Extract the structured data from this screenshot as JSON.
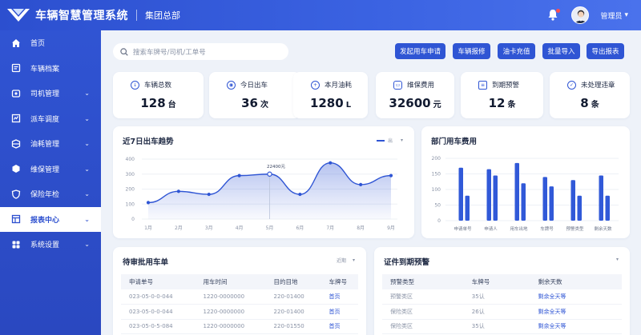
{
  "header": {
    "app_title": "车辆智慧管理系统",
    "org": "集团总部",
    "user_name": "管理员"
  },
  "sidebar": {
    "items": [
      {
        "label": "首页",
        "icon": "home-icon",
        "has_children": false
      },
      {
        "label": "车辆档案",
        "icon": "vehicle-file-icon",
        "has_children": false
      },
      {
        "label": "司机管理",
        "icon": "driver-icon",
        "has_children": true
      },
      {
        "label": "派车调度",
        "icon": "dispatch-icon",
        "has_children": true
      },
      {
        "label": "油耗管理",
        "icon": "fuel-icon",
        "has_children": true
      },
      {
        "label": "维保管理",
        "icon": "maintenance-icon",
        "has_children": true
      },
      {
        "label": "保险年检",
        "icon": "insurance-icon",
        "has_children": true
      },
      {
        "label": "报表中心",
        "icon": "report-icon",
        "has_children": true,
        "active": true
      },
      {
        "label": "系统设置",
        "icon": "settings-icon",
        "has_children": true
      }
    ]
  },
  "search": {
    "placeholder": "搜索车牌号/司机/工单号"
  },
  "actions": [
    "发起用车申请",
    "车辆报修",
    "油卡充值",
    "批量导入",
    "导出报表"
  ],
  "stats": [
    {
      "label": "车辆总数",
      "value": "128",
      "unit": "台"
    },
    {
      "label": "今日出车",
      "value": "36",
      "unit": "次"
    },
    {
      "label": "本月油耗",
      "value": "1280",
      "unit": "L"
    },
    {
      "label": "维保费用",
      "value": "32600",
      "unit": "元"
    },
    {
      "label": "到期预警",
      "value": "12",
      "unit": "条"
    },
    {
      "label": "未处理违章",
      "value": "8",
      "unit": "条"
    }
  ],
  "trend_card": {
    "title": "近7日出车趋势",
    "legend": "出"
  },
  "dept_card": {
    "title": "部门用车费用"
  },
  "pending_card": {
    "title": "待审批用车单",
    "filter": "近期",
    "columns": [
      "申请单号",
      "用车时间",
      "目的目地",
      "车牌号"
    ],
    "rows": [
      [
        "023-05-0-0-044",
        "1220-0000000",
        "220-01400",
        "首页"
      ],
      [
        "023-05-0-0-044",
        "1220-0000000",
        "220-01400",
        "首页"
      ],
      [
        "023-05-0-5-084",
        "1220-0000000",
        "220-01550",
        "首页"
      ]
    ]
  },
  "cert_card": {
    "title": "证件到期预警",
    "columns": [
      "预警类型",
      "车牌号",
      "剩余天数"
    ],
    "rows": [
      [
        "预警类区",
        "35认",
        "剩余全天等"
      ],
      [
        "保险类区",
        "26认",
        "剩余全天等"
      ],
      [
        "保险类区",
        "35认",
        "剩余全天等"
      ]
    ]
  },
  "chart_data": [
    {
      "type": "line",
      "title": "近7日出车趋势",
      "x": [
        "1月",
        "2月",
        "3月",
        "4月",
        "5月",
        "6月",
        "7月",
        "8月",
        "9月"
      ],
      "values": [
        110,
        185,
        165,
        290,
        300,
        165,
        375,
        230,
        290
      ],
      "ylim": [
        0,
        400
      ],
      "yticks": [
        0,
        100,
        200,
        300,
        400
      ],
      "annotation": {
        "label": "22400元",
        "index": 4
      },
      "color": "#2f55d4"
    },
    {
      "type": "bar",
      "title": "部门用车费用",
      "categories": [
        "申请单号",
        "申请人",
        "用车出地",
        "车牌号",
        "预警类型",
        "剩余天数"
      ],
      "series": [
        {
          "values": [
            170,
            165,
            185,
            140,
            130,
            145
          ]
        },
        {
          "values": [
            80,
            145,
            120,
            110,
            80,
            80
          ]
        }
      ],
      "ylim": [
        0,
        200
      ],
      "yticks": [
        0,
        50,
        100,
        150,
        200
      ],
      "color": "#3159d8"
    }
  ]
}
